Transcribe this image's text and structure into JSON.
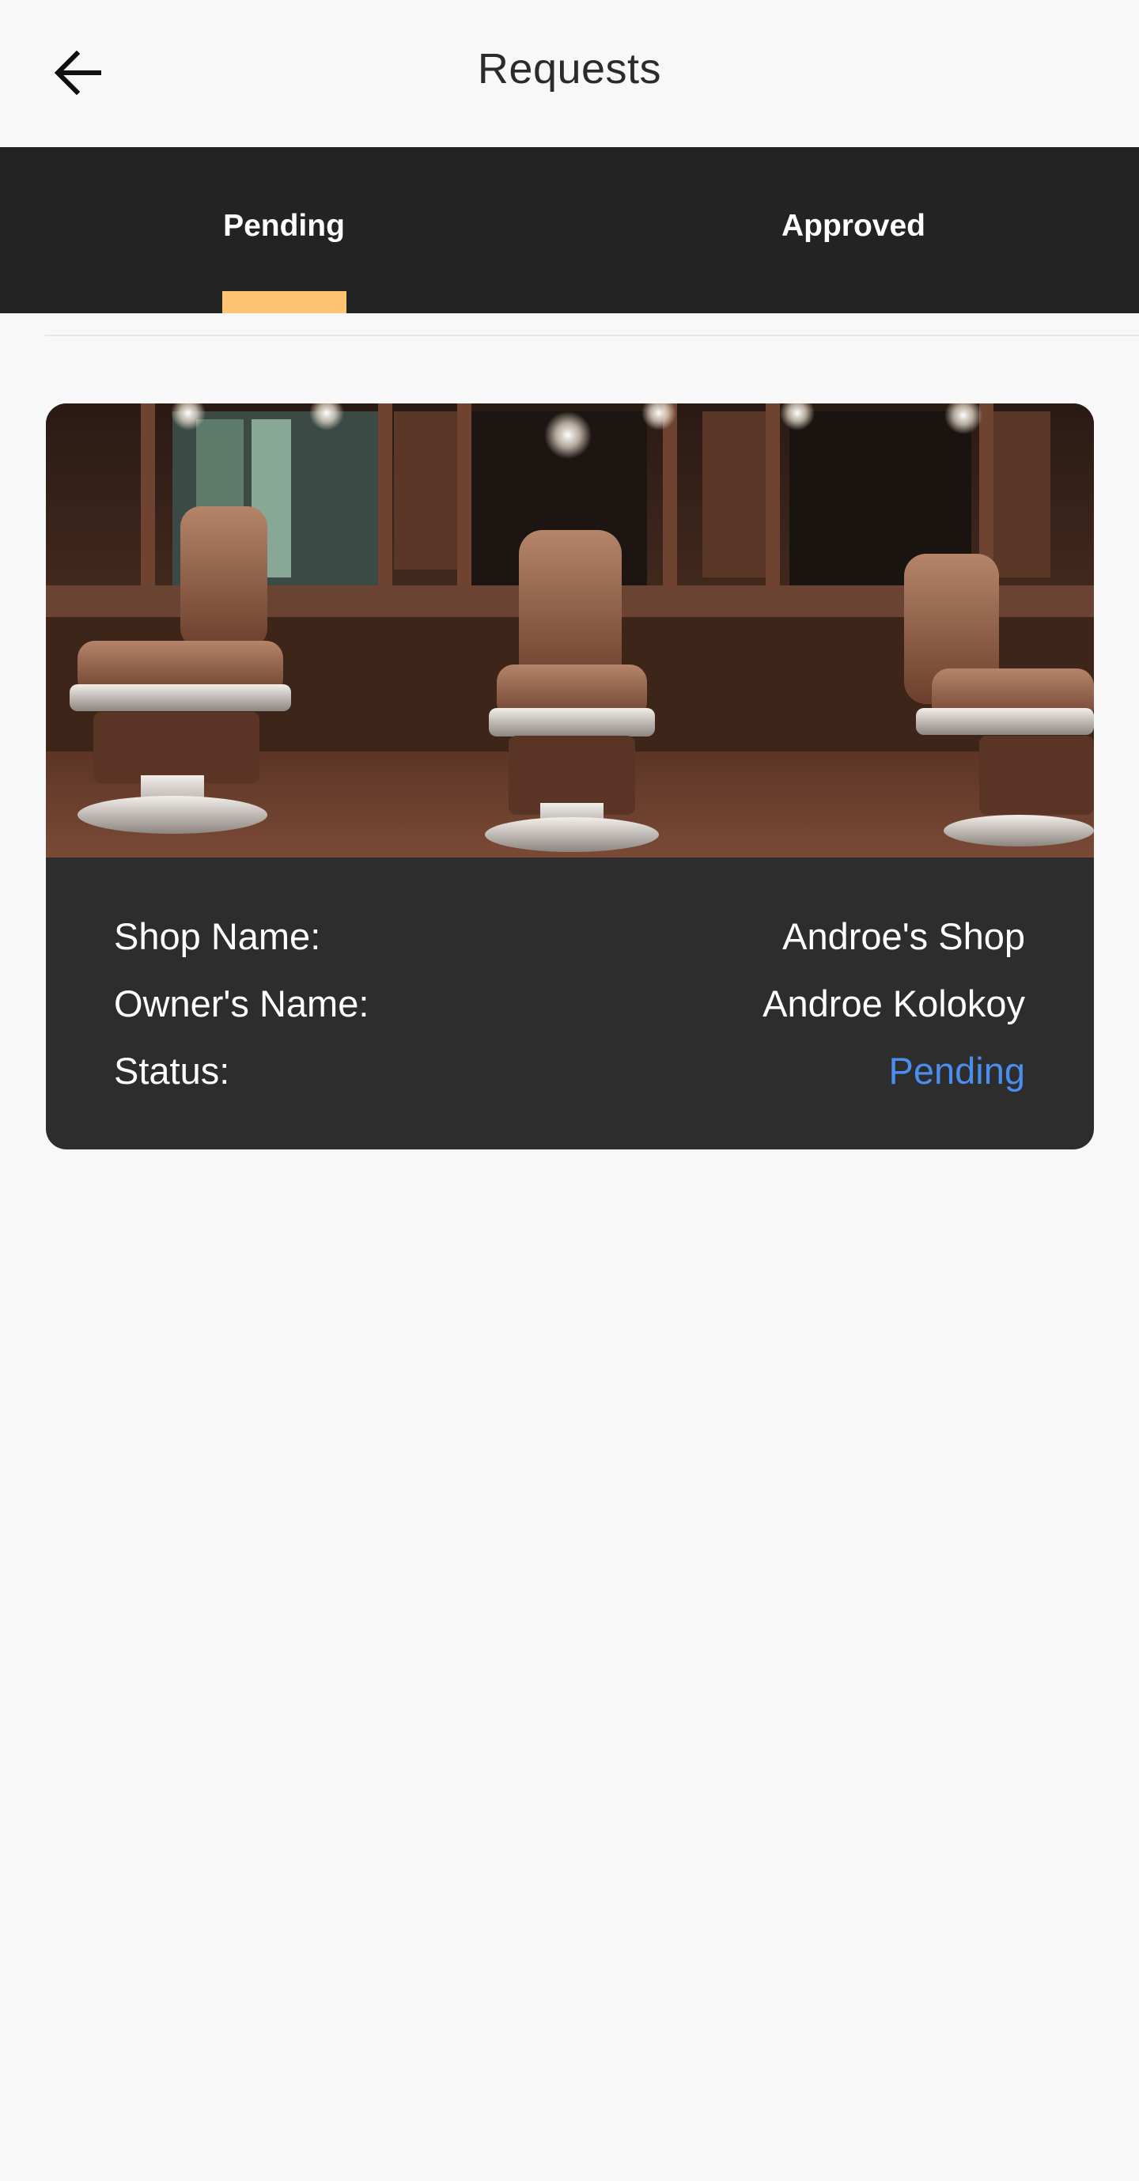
{
  "header": {
    "title": "Requests",
    "back_icon": "arrow-left-icon"
  },
  "tabs": [
    {
      "label": "Pending",
      "selected": true
    },
    {
      "label": "Approved",
      "selected": false
    }
  ],
  "colors": {
    "tab_bar_bg": "#232323",
    "tab_indicator": "#ffc471",
    "card_bg": "#2d2d2d",
    "status_pending": "#4a8ff0",
    "page_bg": "#f8f8f8"
  },
  "request": {
    "image_description": "barbershop-interior",
    "fields": [
      {
        "label": "Shop Name:",
        "value": "Androe's Shop"
      },
      {
        "label": "Owner's Name:",
        "value": "Androe Kolokoy"
      },
      {
        "label": "Status:",
        "value": "Pending"
      }
    ]
  }
}
